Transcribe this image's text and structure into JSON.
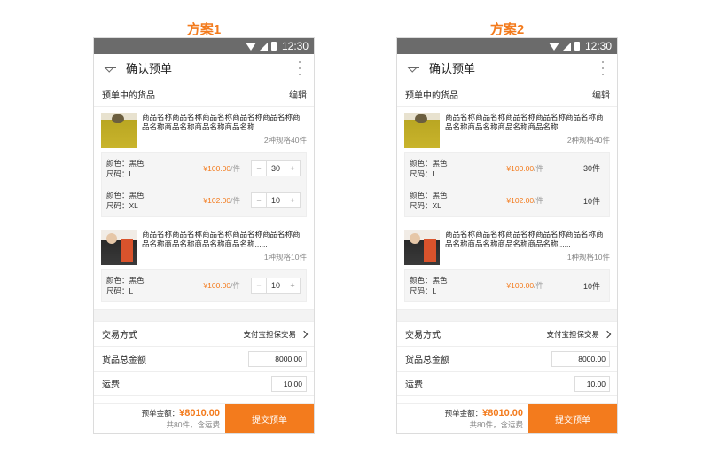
{
  "plan1_title": "方案1",
  "plan2_title": "方案2",
  "status": {
    "time": "12:30"
  },
  "nav": {
    "title": "确认预单"
  },
  "goods_section": {
    "title": "预单中的货品",
    "edit": "编辑"
  },
  "products": [
    {
      "name": "商品名称商品名称商品名称商品名称商品名称商品名称商品名称商品名称商品名称......",
      "count": "2种规格40件",
      "skus": [
        {
          "color": "颜色：黑色",
          "size": "尺码：L",
          "price": "¥100.00",
          "unit": "/件",
          "qty": "30",
          "qty_text": "30件"
        },
        {
          "color": "颜色：黑色",
          "size": "尺码：XL",
          "price": "¥102.00",
          "unit": "/件",
          "qty": "10",
          "qty_text": "10件"
        }
      ]
    },
    {
      "name": "商品名称商品名称商品名称商品名称商品名称商品名称商品名称商品名称商品名称......",
      "count": "1种规格10件",
      "skus": [
        {
          "color": "颜色：黑色",
          "size": "尺码：L",
          "price": "¥100.00",
          "unit": "/件",
          "qty": "10",
          "qty_text": "10件"
        }
      ]
    }
  ],
  "stepper": {
    "minus": "−",
    "plus": "+"
  },
  "trade": {
    "label": "交易方式",
    "value": "支付宝担保交易"
  },
  "total": {
    "label": "货品总金额",
    "value": "8000.00"
  },
  "shipping": {
    "label": "运费",
    "value": "10.00"
  },
  "footer": {
    "amount_label": "预单金额：",
    "amount": "¥8010.00",
    "summary": "共80件，含运费",
    "submit": "提交预单"
  },
  "colors": {
    "accent": "#f37b1d",
    "statusbar": "#6b6b6b"
  }
}
